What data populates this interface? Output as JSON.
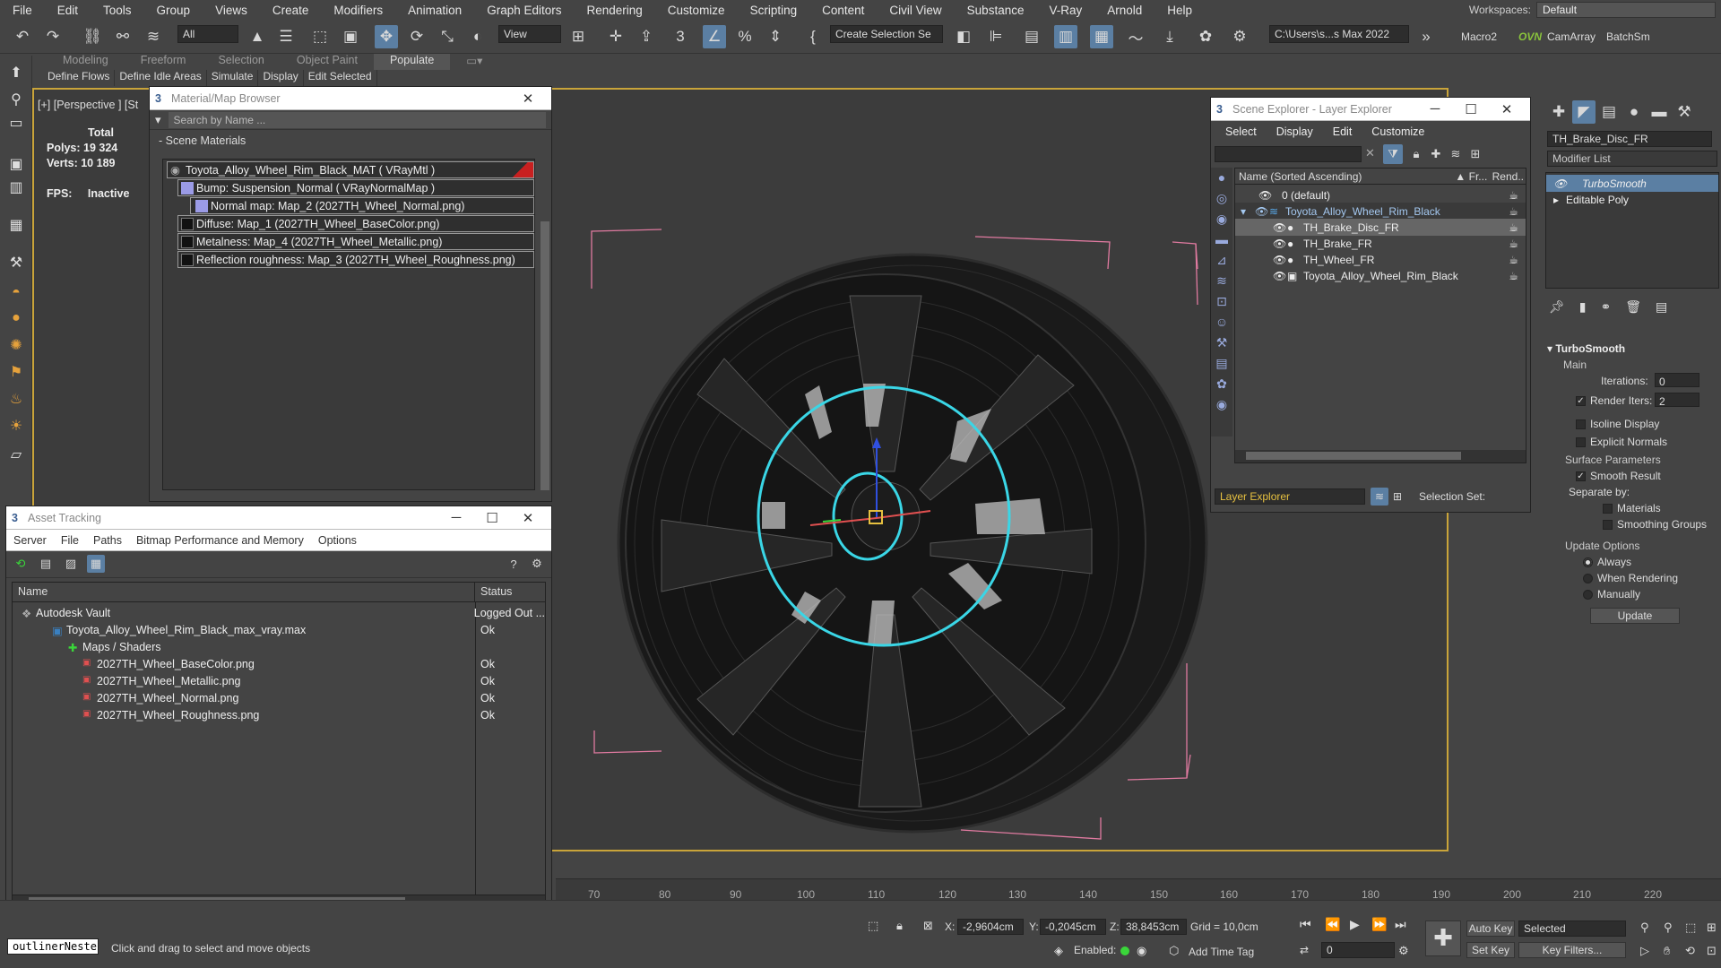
{
  "menu": [
    "File",
    "Edit",
    "Tools",
    "Group",
    "Views",
    "Create",
    "Modifiers",
    "Animation",
    "Graph Editors",
    "Rendering",
    "Customize",
    "Scripting",
    "Content",
    "Civil View",
    "Substance",
    "V-Ray",
    "Arnold",
    "Help"
  ],
  "workspaces": {
    "label": "Workspaces:",
    "value": "Default"
  },
  "toolbar": {
    "filter_dropdown": "All",
    "view_dropdown": "View",
    "selection_set": "Create Selection Se",
    "project_path": "C:\\Users\\s...s Max 2022",
    "macro2": "Macro2",
    "camarray": "CamArray",
    "batchsm": "BatchSm",
    "ovn": "OVN"
  },
  "ribbon": {
    "tabs": [
      "Modeling",
      "Freeform",
      "Selection",
      "Object Paint",
      "Populate"
    ],
    "active": "Populate",
    "sub_items": [
      "Define Flows",
      "Define Idle Areas",
      "Simulate",
      "Display",
      "Edit Selected"
    ]
  },
  "viewport": {
    "label": "[+] [Perspective ] [St",
    "stats": {
      "total_label": "Total",
      "polys_label": "Polys:",
      "polys": "19 324",
      "verts_label": "Verts:",
      "verts": "10 189",
      "fps_label": "FPS:",
      "fps": "Inactive"
    }
  },
  "material_browser": {
    "title": "Material/Map Browser",
    "search_placeholder": "Search by Name ...",
    "group": "- Scene Materials",
    "items": [
      "Toyota_Alloy_Wheel_Rim_Black_MAT  ( VRayMtl )",
      "Bump: Suspension_Normal  ( VRayNormalMap )",
      "Normal map: Map_2 (2027TH_Wheel_Normal.png)",
      "Diffuse: Map_1 (2027TH_Wheel_BaseColor.png)",
      "Metalness: Map_4 (2027TH_Wheel_Metallic.png)",
      "Reflection roughness: Map_3 (2027TH_Wheel_Roughness.png)"
    ]
  },
  "asset_tracking": {
    "title": "Asset Tracking",
    "menu": [
      "Server",
      "File",
      "Paths",
      "Bitmap Performance and Memory",
      "Options"
    ],
    "columns": [
      "Name",
      "Status"
    ],
    "rows": [
      {
        "name": "Autodesk Vault",
        "status": "Logged Out ..."
      },
      {
        "name": "Toyota_Alloy_Wheel_Rim_Black_max_vray.max",
        "status": "Ok"
      },
      {
        "name": "Maps / Shaders",
        "status": ""
      },
      {
        "name": "2027TH_Wheel_BaseColor.png",
        "status": "Ok"
      },
      {
        "name": "2027TH_Wheel_Metallic.png",
        "status": "Ok"
      },
      {
        "name": "2027TH_Wheel_Normal.png",
        "status": "Ok"
      },
      {
        "name": "2027TH_Wheel_Roughness.png",
        "status": "Ok"
      }
    ]
  },
  "scene_explorer": {
    "title": "Scene Explorer - Layer Explorer",
    "menu": [
      "Select",
      "Display",
      "Edit",
      "Customize"
    ],
    "columns": [
      "Name (Sorted Ascending)",
      "▲ Fr...",
      "Rend.."
    ],
    "rows": [
      {
        "name": "0 (default)",
        "selected": false
      },
      {
        "name": "Toyota_Alloy_Wheel_Rim_Black",
        "selected": false
      },
      {
        "name": "TH_Brake_Disc_FR",
        "selected": true
      },
      {
        "name": "TH_Brake_FR",
        "selected": false
      },
      {
        "name": "TH_Wheel_FR",
        "selected": false
      },
      {
        "name": "Toyota_Alloy_Wheel_Rim_Black",
        "selected": false
      }
    ],
    "footer_dropdown": "Layer Explorer",
    "selection_set_label": "Selection Set:"
  },
  "command_panel": {
    "object_name": "TH_Brake_Disc_FR",
    "modifier_list": "Modifier List",
    "stack": [
      "TurboSmooth",
      "Editable Poly"
    ],
    "rollout_title": "TurboSmooth",
    "main_label": "Main",
    "iterations_label": "Iterations:",
    "iterations": "0",
    "render_iters_label": "Render Iters:",
    "render_iters": "2",
    "isoline": "Isoline Display",
    "explicit_normals": "Explicit Normals",
    "surface_params": "Surface Parameters",
    "smooth_result": "Smooth Result",
    "separate_by": "Separate by:",
    "materials": "Materials",
    "smoothing_groups": "Smoothing Groups",
    "update_options": "Update Options",
    "always": "Always",
    "when_rendering": "When Rendering",
    "manually": "Manually",
    "update_btn": "Update"
  },
  "timeline": {
    "ticks": [
      "70",
      "80",
      "90",
      "100",
      "110",
      "120",
      "130",
      "140",
      "150",
      "160",
      "170",
      "180",
      "190",
      "200",
      "210",
      "220"
    ]
  },
  "status": {
    "script_box": "outlinerNeste",
    "prompt": "Click and drag to select and move objects",
    "x_label": "X:",
    "x": "-2,9604cm",
    "y_label": "Y:",
    "y": "-0,2045cm",
    "z_label": "Z:",
    "z": "38,8453cm",
    "grid": "Grid = 10,0cm",
    "enabled_label": "Enabled:",
    "add_time_tag": "Add Time Tag",
    "auto_key": "Auto Key",
    "set_key": "Set Key",
    "selected": "Selected",
    "key_filters": "Key Filters...",
    "frame": "0"
  },
  "colors": {
    "accent": "#5b7fa3",
    "viewport_border": "#c9a43a",
    "selection": "#3ad6e6",
    "gizmo_red": "#e05050"
  }
}
